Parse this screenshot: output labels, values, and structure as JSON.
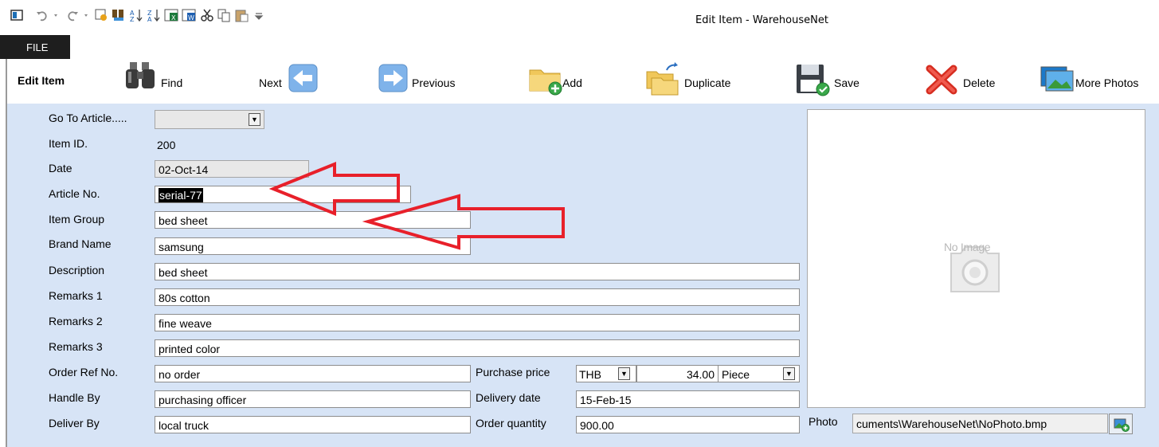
{
  "window": {
    "title": "Edit Item - WarehouseNet",
    "file_tab": "FILE"
  },
  "quick_access_icons": [
    "app-icon",
    "undo-icon",
    "redo-icon",
    "query-icon",
    "filter-icon",
    "sort-ascending-icon",
    "sort-descending-icon",
    "export-excel-icon",
    "export-word-icon",
    "cut-icon",
    "copy-icon",
    "paste-icon",
    "customize-toolbar-icon"
  ],
  "ribbon": {
    "section_title": "Edit Item",
    "find": "Find",
    "next": "Next",
    "previous": "Previous",
    "add": "Add",
    "duplicate": "Duplicate",
    "save": "Save",
    "delete": "Delete",
    "more_photos": "More Photos"
  },
  "form": {
    "goto_label": "Go To Article.....",
    "goto_value": "",
    "item_id_label": "Item ID.",
    "item_id_value": "200",
    "date_label": "Date",
    "date_value": "02-Oct-14",
    "article_no_label": "Article No.",
    "article_no_value": "serial-77",
    "item_group_label": "Item Group",
    "item_group_value": "bed sheet",
    "brand_label": "Brand Name",
    "brand_value": "samsung",
    "description_label": "Description",
    "description_value": "bed sheet",
    "remarks1_label": "Remarks 1",
    "remarks1_value": "80s cotton",
    "remarks2_label": "Remarks 2",
    "remarks2_value": "fine weave",
    "remarks3_label": "Remarks 3",
    "remarks3_value": "printed color",
    "order_ref_label": "Order Ref No.",
    "order_ref_value": "no order",
    "handle_by_label": "Handle By",
    "handle_by_value": "purchasing officer",
    "deliver_by_label": "Deliver By",
    "deliver_by_value": "local truck",
    "purchase_price_label": "Purchase price",
    "currency_value": "THB",
    "price_value": "34.00",
    "unit_value": "Piece",
    "delivery_date_label": "Delivery date",
    "delivery_date_value": "15-Feb-15",
    "order_qty_label": "Order quantity",
    "order_qty_value": "900.00"
  },
  "photo": {
    "placeholder_text": "No Image",
    "label": "Photo",
    "path_value": "cuments\\WarehouseNet\\NoPhoto.bmp"
  },
  "colors": {
    "form_background": "#d7e4f6",
    "annotation_arrow": "#e8202a",
    "file_tab": "#1e1e1e"
  }
}
